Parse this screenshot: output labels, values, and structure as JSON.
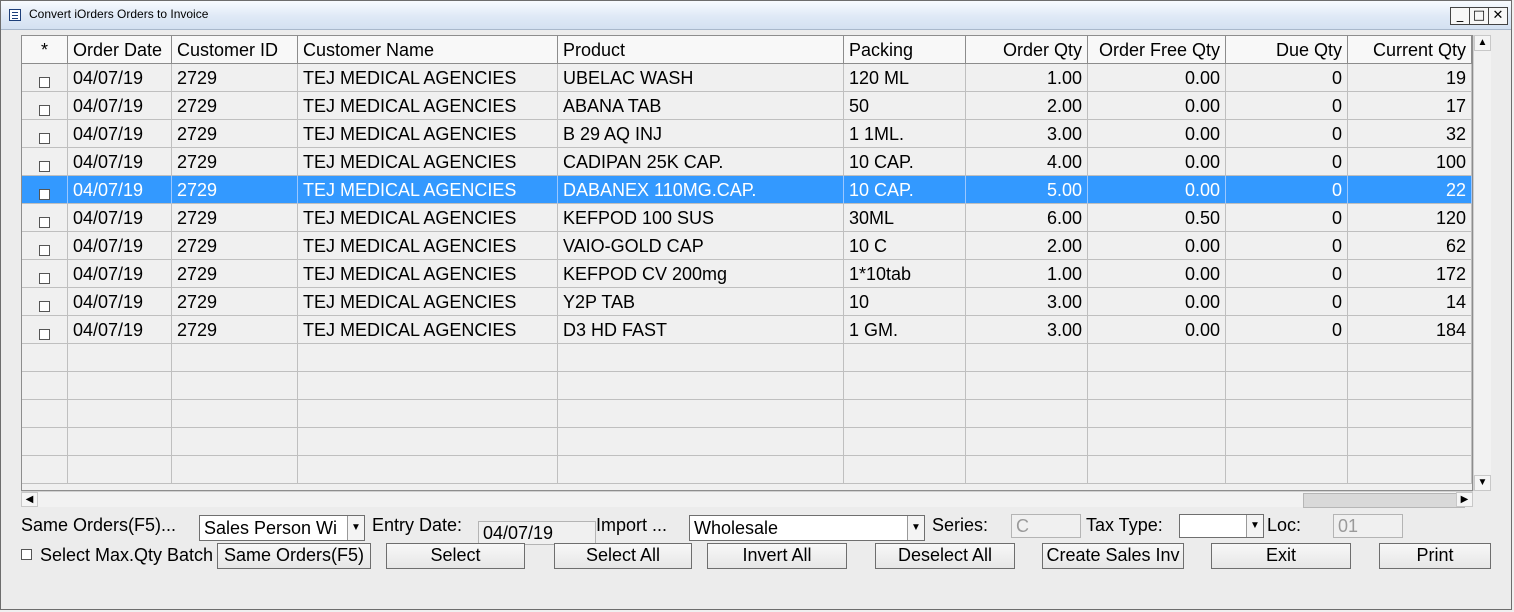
{
  "window": {
    "title": "Convert iOrders Orders to Invoice",
    "minimize": "_",
    "maximize": "□",
    "close": "✕"
  },
  "grid": {
    "columns": [
      "*",
      "Order Date",
      "Customer ID",
      "Customer Name",
      "Product",
      "Packing",
      "Order Qty",
      "Order Free Qty",
      "Due Qty",
      "Current Qty"
    ],
    "rows": [
      [
        "",
        "04/07/19",
        "2729",
        "TEJ MEDICAL AGENCIES",
        "UBELAC WASH",
        "120 ML",
        "1.00",
        "0.00",
        "0",
        "19"
      ],
      [
        "",
        "04/07/19",
        "2729",
        "TEJ MEDICAL AGENCIES",
        "ABANA TAB",
        "50",
        "2.00",
        "0.00",
        "0",
        "17"
      ],
      [
        "",
        "04/07/19",
        "2729",
        "TEJ MEDICAL AGENCIES",
        "B 29 AQ INJ",
        "1 1ML.",
        "3.00",
        "0.00",
        "0",
        "32"
      ],
      [
        "",
        "04/07/19",
        "2729",
        "TEJ MEDICAL AGENCIES",
        "CADIPAN 25K CAP.",
        "10 CAP.",
        "4.00",
        "0.00",
        "0",
        "100"
      ],
      [
        "",
        "04/07/19",
        "2729",
        "TEJ MEDICAL AGENCIES",
        "DABANEX 110MG.CAP.",
        "10 CAP.",
        "5.00",
        "0.00",
        "0",
        "22"
      ],
      [
        "",
        "04/07/19",
        "2729",
        "TEJ MEDICAL AGENCIES",
        "KEFPOD 100 SUS",
        "30ML",
        "6.00",
        "0.50",
        "0",
        "120"
      ],
      [
        "",
        "04/07/19",
        "2729",
        "TEJ MEDICAL AGENCIES",
        "VAIO-GOLD CAP",
        "10 C",
        "2.00",
        "0.00",
        "0",
        "62"
      ],
      [
        "",
        "04/07/19",
        "2729",
        "TEJ MEDICAL AGENCIES",
        "KEFPOD CV 200mg",
        "1*10tab",
        "1.00",
        "0.00",
        "0",
        "172"
      ],
      [
        "",
        "04/07/19",
        "2729",
        "TEJ MEDICAL AGENCIES",
        "Y2P TAB",
        "10",
        "3.00",
        "0.00",
        "0",
        "14"
      ],
      [
        "",
        "04/07/19",
        "2729",
        "TEJ MEDICAL AGENCIES",
        "D3 HD FAST",
        "1 GM.",
        "3.00",
        "0.00",
        "0",
        "184"
      ]
    ],
    "selected_row": 4
  },
  "footer": {
    "same_orders_label": "Same Orders(F5)...",
    "sales_person_value": "Sales Person Wi",
    "entry_date_label": "Entry Date:",
    "entry_date_value": "04/07/19",
    "import_label": "Import ...",
    "import_value": "Wholesale",
    "series_label": "Series:",
    "series_value": "C",
    "tax_type_label": "Tax Type:",
    "tax_type_value": "",
    "loc_label": "Loc:",
    "loc_value": "01",
    "select_max_label": "Select Max.Qty Batch",
    "buttons": {
      "same_orders": "Same Orders(F5)",
      "select": "Select",
      "select_all": "Select All",
      "invert_all": "Invert All",
      "deselect_all": "Deselect All",
      "create_sales_inv": "Create Sales Inv",
      "exit": "Exit",
      "print": "Print"
    }
  }
}
